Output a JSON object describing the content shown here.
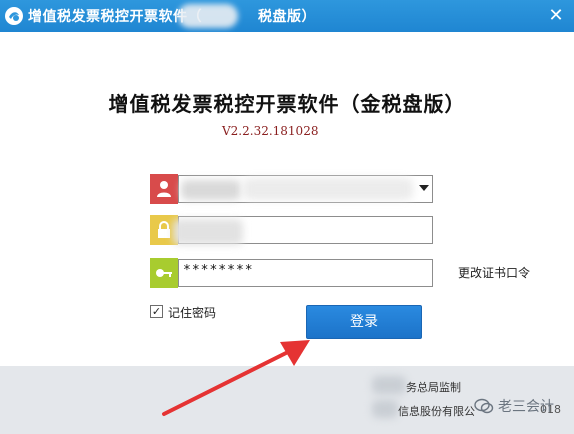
{
  "window": {
    "title": "增值税发票税控开票软件（",
    "title_suffix": "税盘版）",
    "close_glyph": "✕"
  },
  "main": {
    "heading": "增值税发票税控开票软件（金税盘版）",
    "version": "V2.2.32.181028"
  },
  "fields": {
    "cert_password": "********",
    "change_cert_label": "更改证书口令"
  },
  "remember": {
    "label": "记住密码",
    "checked": true
  },
  "login": {
    "label": "登录"
  },
  "footer": {
    "line1": "务总局监制",
    "line2": "信息股份有限公",
    "year_fragment": "018"
  },
  "watermark": {
    "text": "老三会计"
  },
  "colors": {
    "titlebar": "#1f86d2",
    "user_icon_bg": "#d84b4b",
    "lock_icon_bg": "#e9c94a",
    "key_icon_bg": "#a8cc2f",
    "login_button": "#1c73c9",
    "arrow": "#e53333"
  }
}
